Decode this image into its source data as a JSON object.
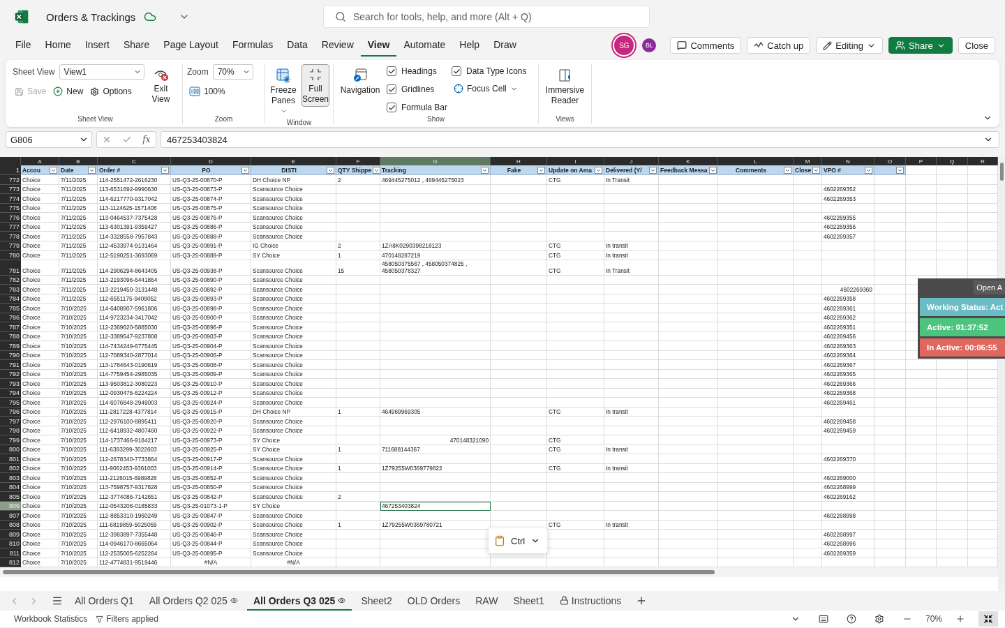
{
  "app": {
    "title": "Orders & Trackings",
    "search_placeholder": "Search for tools, help, and more (Alt + Q)"
  },
  "menu": [
    {
      "label": "File",
      "selected": false
    },
    {
      "label": "Home",
      "selected": false
    },
    {
      "label": "Insert",
      "selected": false
    },
    {
      "label": "Share",
      "selected": false
    },
    {
      "label": "Page Layout",
      "selected": false
    },
    {
      "label": "Formulas",
      "selected": false
    },
    {
      "label": "Data",
      "selected": false
    },
    {
      "label": "Review",
      "selected": false
    },
    {
      "label": "View",
      "selected": true
    },
    {
      "label": "Automate",
      "selected": false
    },
    {
      "label": "Help",
      "selected": false
    },
    {
      "label": "Draw",
      "selected": false
    }
  ],
  "collaborators": [
    {
      "initials": "SG",
      "color": "#c4297f"
    },
    {
      "initials": "BL",
      "color": "#8c2a9c"
    }
  ],
  "actions": [
    {
      "label": "Comments",
      "kind": "comments"
    },
    {
      "label": "Catch up",
      "kind": "catchup"
    },
    {
      "label": "Editing",
      "kind": "editing"
    },
    {
      "label": "Share",
      "kind": "share"
    },
    {
      "label": "Close",
      "kind": "close"
    }
  ],
  "ribbon": {
    "sheet_view": {
      "label": "Sheet View",
      "field_label": "Sheet View",
      "view": "View1",
      "exit": "Exit View",
      "save": {
        "label": "Save",
        "disabled": true
      },
      "new": "New",
      "options": "Options"
    },
    "zoom": {
      "label": "Zoom",
      "field_label": "Zoom",
      "value": "70%",
      "reset": "100%"
    },
    "window": {
      "label": "Window",
      "freeze": "Freeze Panes",
      "full_screen": {
        "label": "Full Screen",
        "pressed": true
      }
    },
    "show": {
      "label": "Show",
      "navigation": "Navigation",
      "options": [
        {
          "label": "Headings",
          "checked": true
        },
        {
          "label": "Gridlines",
          "checked": true
        },
        {
          "label": "Formula Bar",
          "checked": true
        },
        {
          "label": "Data Type Icons",
          "checked": true
        }
      ],
      "focus_cell": "Focus Cell"
    },
    "views": {
      "label": "Views",
      "immersive": "Immersive Reader"
    }
  },
  "formula_bar": {
    "name_box": "G806",
    "function_label": "fx",
    "value": "467253403824"
  },
  "columns": [
    {
      "letter": "A",
      "header": "Accou",
      "filter": true,
      "selected": false
    },
    {
      "letter": "B",
      "header": "Date",
      "filter": true,
      "selected": false
    },
    {
      "letter": "C",
      "header": "Order #",
      "filter": true,
      "selected": false
    },
    {
      "letter": "D",
      "header": "PO",
      "filter": true,
      "selected": false
    },
    {
      "letter": "E",
      "header": "DISTI",
      "filter": true,
      "selected": false
    },
    {
      "letter": "F",
      "header": "QTY Shippe",
      "filter": true,
      "selected": false
    },
    {
      "letter": "G",
      "header": "Tracking",
      "filter": true,
      "selected": true
    },
    {
      "letter": "H",
      "header": "Fake",
      "filter": true,
      "selected": false
    },
    {
      "letter": "I",
      "header": "Update on Ama",
      "filter": true,
      "selected": false
    },
    {
      "letter": "J",
      "header": "Delivered (Y/",
      "filter": true,
      "selected": false
    },
    {
      "letter": "K",
      "header": "Feedback Messa",
      "filter": true,
      "selected": false
    },
    {
      "letter": "L",
      "header": "Comments",
      "filter": true,
      "selected": false
    },
    {
      "letter": "M",
      "header": "Close",
      "filter": true,
      "selected": false
    },
    {
      "letter": "N",
      "header": "VPO #",
      "filter": true,
      "selected": false
    },
    {
      "letter": "O",
      "filter": true,
      "selected": false
    },
    {
      "letter": "P",
      "filter": false,
      "selected": false
    },
    {
      "letter": "Q",
      "filter": false,
      "selected": false
    },
    {
      "letter": "R",
      "filter": false,
      "selected": false
    }
  ],
  "header_row": "1",
  "rows": [
    {
      "num": "772",
      "selected": false,
      "cells": {
        "A": "Choice",
        "B": "7/11/2025",
        "C": "114-2551472-2616230",
        "D": "US-Q3-25-00870-P",
        "E": "DH Choice NP",
        "F": "2",
        "G": "469445275012 , 469445275023",
        "I": "CTG",
        "J": "In Transit"
      }
    },
    {
      "num": "773",
      "selected": false,
      "cells": {
        "A": "Choice",
        "B": "7/11/2025",
        "C": "113-6531692-9990630",
        "D": "US-Q3-25-00873-P",
        "E": "Scansource Choice",
        "N": "4602269352"
      }
    },
    {
      "num": "774",
      "selected": false,
      "cells": {
        "A": "Choice",
        "B": "7/11/2025",
        "C": "114-6217770-9317042",
        "D": "US-Q3-25-00874-P",
        "E": "Scansource Choice",
        "N": "4602269353"
      }
    },
    {
      "num": "775",
      "selected": false,
      "cells": {
        "A": "Choice",
        "B": "7/11/2025",
        "C": "113-1124625-1571408",
        "D": "US-Q3-25-00875-P",
        "E": "Scansource Choice"
      }
    },
    {
      "num": "776",
      "selected": false,
      "cells": {
        "A": "Choice",
        "B": "7/11/2025",
        "C": "113-0464537-7375428",
        "D": "US-Q3-25-00876-P",
        "E": "Scansource Choice",
        "N": "4602269355"
      }
    },
    {
      "num": "777",
      "selected": false,
      "cells": {
        "A": "Choice",
        "B": "7/11/2025",
        "C": "113-6301391-9359427",
        "D": "US-Q3-25-00886-P",
        "E": "Scansource Choice",
        "N": "4602269356"
      }
    },
    {
      "num": "778",
      "selected": false,
      "cells": {
        "A": "Choice",
        "B": "7/11/2025",
        "C": "114-3328558-7957843",
        "D": "US-Q3-25-00888-P",
        "E": "Scansource Choice",
        "N": "4602269357"
      }
    },
    {
      "num": "779",
      "selected": false,
      "cells": {
        "A": "Choice",
        "B": "7/11/2025",
        "C": "112-4533974-9131464",
        "D": "US-Q3-25-00891-P",
        "E": "IG Choice",
        "F": "2",
        "G": "1ZA8K0290398218123",
        "I": "CTG",
        "J": "In transit"
      }
    },
    {
      "num": "780",
      "selected": false,
      "cells": {
        "A": "Choice",
        "B": "7/11/2025",
        "C": "112-5190251-3693069",
        "D": "US-Q3-25-00889-P",
        "E": "SY Choice",
        "F": "1",
        "G": "470148287219",
        "I": "CTG",
        "J": "In transit"
      }
    },
    {
      "num": "781",
      "selected": false,
      "cells": {
        "A": "Choice",
        "B": "7/11/2025",
        "C": "114-2906294-8643405",
        "D": "US-Q3-25-00938-P",
        "E": "Scansource Choice",
        "F": "15",
        "G": [
          "458050375567 , 458050374825 ,",
          "458050378327"
        ],
        "I": "CTG",
        "J": "In Transit"
      }
    },
    {
      "num": "782",
      "selected": false,
      "cells": {
        "A": "Choice",
        "B": "7/11/2025",
        "C": "113-2193096-6441864",
        "D": "US-Q3-25-00890-P",
        "E": "Scansource Choice"
      }
    },
    {
      "num": "783",
      "selected": false,
      "align_right": {
        "N": true
      },
      "cells": {
        "A": "Choice",
        "B": "7/11/2025",
        "C": "113-2219450-3131448",
        "D": "US-Q3-25-00892-P",
        "E": "Scansource Choice",
        "N": "4602269360"
      }
    },
    {
      "num": "784",
      "selected": false,
      "cells": {
        "A": "Choice",
        "B": "7/11/2025",
        "C": "112-6551175-9409052",
        "D": "US-Q3-25-00893-P",
        "E": "Scansource Choice",
        "N": "4602269358"
      }
    },
    {
      "num": "785",
      "selected": false,
      "cells": {
        "A": "Choice",
        "B": "7/10/2025",
        "C": "114-6408907-5961806",
        "D": "US-Q3-25-00898-P",
        "E": "Scansource Choice",
        "N": "4602269361"
      }
    },
    {
      "num": "786",
      "selected": false,
      "cells": {
        "A": "Choice",
        "B": "7/10/2025",
        "C": "114-9723234-3417042",
        "D": "US-Q3-25-00900-P",
        "E": "Scansource Choice",
        "N": "4602269362"
      }
    },
    {
      "num": "787",
      "selected": false,
      "cells": {
        "A": "Choice",
        "B": "7/10/2025",
        "C": "112-2369620-5885030",
        "D": "US-Q3-25-00896-P",
        "E": "Scansource Choice",
        "N": "4602269351"
      }
    },
    {
      "num": "788",
      "selected": false,
      "cells": {
        "A": "Choice",
        "B": "7/10/2025",
        "C": "112-3389547-9237808",
        "D": "US-Q3-25-00903-P",
        "E": "Scansource Choice",
        "N": "4602269456"
      }
    },
    {
      "num": "789",
      "selected": false,
      "cells": {
        "A": "Choice",
        "B": "7/10/2025",
        "C": "114-7434249-6775445",
        "D": "US-Q3-25-00904-P",
        "E": "Scansource Choice",
        "N": "4602269363"
      }
    },
    {
      "num": "790",
      "selected": false,
      "cells": {
        "A": "Choice",
        "B": "7/10/2025",
        "C": "112-7089340-2877014",
        "D": "US-Q3-25-00906-P",
        "E": "Scansource Choice",
        "N": "4602269364"
      }
    },
    {
      "num": "791",
      "selected": false,
      "cells": {
        "A": "Choice",
        "B": "7/10/2025",
        "C": "113-1784643-0190619",
        "D": "US-Q3-25-00908-P",
        "E": "Scansource Choice",
        "N": "4602269367"
      }
    },
    {
      "num": "792",
      "selected": false,
      "cells": {
        "A": "Choice",
        "B": "7/10/2025",
        "C": "114-7759454-2985035",
        "D": "US-Q3-25-00909-P",
        "E": "Scansource Choice",
        "N": "4602269365"
      }
    },
    {
      "num": "793",
      "selected": false,
      "cells": {
        "A": "Choice",
        "B": "7/10/2025",
        "C": "113-9503812-3080223",
        "D": "US-Q3-25-00910-P",
        "E": "Scansource Choice",
        "N": "4602269366"
      }
    },
    {
      "num": "794",
      "selected": false,
      "cells": {
        "A": "Choice",
        "B": "7/10/2025",
        "C": "112-0930475-6224224",
        "D": "US-Q3-25-00912-P",
        "E": "Scansource Choice",
        "N": "4602269368"
      }
    },
    {
      "num": "795",
      "selected": false,
      "cells": {
        "A": "Choice",
        "B": "7/10/2025",
        "C": "114-6076848-2949003",
        "D": "US-Q3-25-00924-P",
        "E": "Scansource Choice",
        "N": "4602269461"
      }
    },
    {
      "num": "796",
      "selected": false,
      "cells": {
        "A": "Choice",
        "B": "7/10/2025",
        "C": "111-2817228-4377814",
        "D": "US-Q3-25-00915-P",
        "E": "DH Choice NP",
        "F": "1",
        "G": "464969969305",
        "I": "CTG",
        "J": "In transit"
      }
    },
    {
      "num": "797",
      "selected": false,
      "cells": {
        "A": "Choice",
        "B": "7/10/2025",
        "C": "112-2976100-8895411",
        "D": "US-Q3-25-00920-P",
        "E": "Scansource Choice",
        "N": "4602269458"
      }
    },
    {
      "num": "798",
      "selected": false,
      "cells": {
        "A": "Choice",
        "B": "7/10/2025",
        "C": "112-6418932-4807460",
        "D": "US-Q3-25-00922-P",
        "E": "Scansource Choice",
        "N": "4602269459"
      }
    },
    {
      "num": "799",
      "selected": false,
      "align_right": {
        "G": true
      },
      "cells": {
        "A": "Choice",
        "B": "7/10/2025",
        "C": "114-1737466-9184217",
        "D": "US-Q3-25-00973-P",
        "E": "SY Choice",
        "G": "470148321090",
        "I": "CTG"
      }
    },
    {
      "num": "800",
      "selected": false,
      "cells": {
        "A": "Choice",
        "B": "7/10/2025",
        "C": "111-6393299-3022603",
        "D": "US-Q3-25-00925-P",
        "E": "SY Choice",
        "F": "1",
        "G": "711688144367",
        "I": "CTG",
        "J": "In transit"
      }
    },
    {
      "num": "801",
      "selected": false,
      "cells": {
        "A": "Choice",
        "B": "7/10/2025",
        "C": "112-2678340-7733864",
        "D": "US-Q3-25-00917-P",
        "E": "Scansource Choice",
        "N": "4602269370"
      }
    },
    {
      "num": "802",
      "selected": false,
      "cells": {
        "A": "Choice",
        "B": "7/10/2025",
        "C": "111-9062453-9361003",
        "D": "US-Q3-25-00914-P",
        "E": "Scansource Choice",
        "F": "1",
        "G": "1Z79255W0369779822",
        "I": "CTG",
        "J": "In transit"
      }
    },
    {
      "num": "803",
      "selected": false,
      "cells": {
        "A": "Choice",
        "B": "7/10/2025",
        "C": "111-2126015-6989828",
        "D": "US-Q3-25-00852-P",
        "E": "Scansource Choice",
        "N": "4602269000"
      }
    },
    {
      "num": "804",
      "selected": false,
      "cells": {
        "A": "Choice",
        "B": "7/10/2025",
        "C": "113-7598757-9317828",
        "D": "US-Q3-25-00850-P",
        "E": "Scansource Choice",
        "N": "4602268999"
      }
    },
    {
      "num": "805",
      "selected": false,
      "cells": {
        "A": "Choice",
        "B": "7/10/2025",
        "C": "112-3774086-7142651",
        "D": "US-Q3-25-00842-P",
        "E": "Scansource Choice",
        "F": "2",
        "N": "4602269162"
      }
    },
    {
      "num": "806",
      "selected": true,
      "cells": {
        "A": "Choice",
        "B": "7/10/2025",
        "C": "112-0543208-0185833",
        "D": "US-Q3-25-01073-1-P",
        "E": "SY Choice",
        "G": "467253403824"
      }
    },
    {
      "num": "807",
      "selected": false,
      "cells": {
        "A": "Choice",
        "B": "7/10/2025",
        "C": "112-8853310-1960249",
        "D": "US-Q3-25-00847-P",
        "E": "Scansource Choice",
        "N": "4602268998"
      }
    },
    {
      "num": "808",
      "selected": false,
      "cells": {
        "A": "Choice",
        "B": "7/10/2025",
        "C": "111-6819859-5025059",
        "D": "US-Q3-25-00902-P",
        "E": "Scansource Choice",
        "F": "1",
        "G": "1Z79255W0369780721",
        "I": "CTG",
        "J": "In transit"
      }
    },
    {
      "num": "809",
      "selected": false,
      "cells": {
        "A": "Choice",
        "B": "7/10/2025",
        "C": "112-3983897-7355448",
        "D": "US-Q3-25-00846-P",
        "E": "Scansource Choice",
        "N": "4602268997"
      }
    },
    {
      "num": "810",
      "selected": false,
      "cells": {
        "A": "Choice",
        "B": "7/10/2025",
        "C": "114-0946170-8665064",
        "D": "US-Q3-25-00844-P",
        "E": "Scansource Choice",
        "N": "4602268996"
      }
    },
    {
      "num": "811",
      "selected": false,
      "cells": {
        "A": "Choice",
        "B": "7/10/2025",
        "C": "112-2535005-6252264",
        "D": "US-Q3-25-00895-P",
        "E": "Scansource Choice",
        "N": "4602269359"
      }
    },
    {
      "num": "812",
      "selected": false,
      "align_center": {
        "D": true,
        "E": true
      },
      "cells": {
        "A": "Choice",
        "B": "7/10/2025",
        "C": "112-4774831-9519446",
        "D": "#N/A",
        "E": "#N/A"
      }
    }
  ],
  "tracker": {
    "button": "Open A",
    "status": "Working Status: Act",
    "active": "Active: 01:37:52",
    "inactive": "In Active: 00:06:55"
  },
  "paste_options": {
    "label": "Ctrl"
  },
  "sheet_tabs": [
    {
      "label": "All Orders Q1",
      "kind": "plain",
      "selected": false
    },
    {
      "label": "All Orders Q2 025",
      "kind": "watched",
      "selected": false
    },
    {
      "label": "All Orders Q3 025",
      "kind": "watched",
      "selected": true
    },
    {
      "label": "Sheet2",
      "kind": "plain",
      "selected": false
    },
    {
      "label": "OLD Orders",
      "kind": "plain",
      "selected": false
    },
    {
      "label": "RAW",
      "kind": "plain",
      "selected": false
    },
    {
      "label": "Sheet1",
      "kind": "plain",
      "selected": false
    },
    {
      "label": "Instructions",
      "kind": "locked",
      "selected": false
    }
  ],
  "status_bar": {
    "statistics": "Workbook Statistics",
    "filters": "Filters applied",
    "zoom": "70%"
  }
}
